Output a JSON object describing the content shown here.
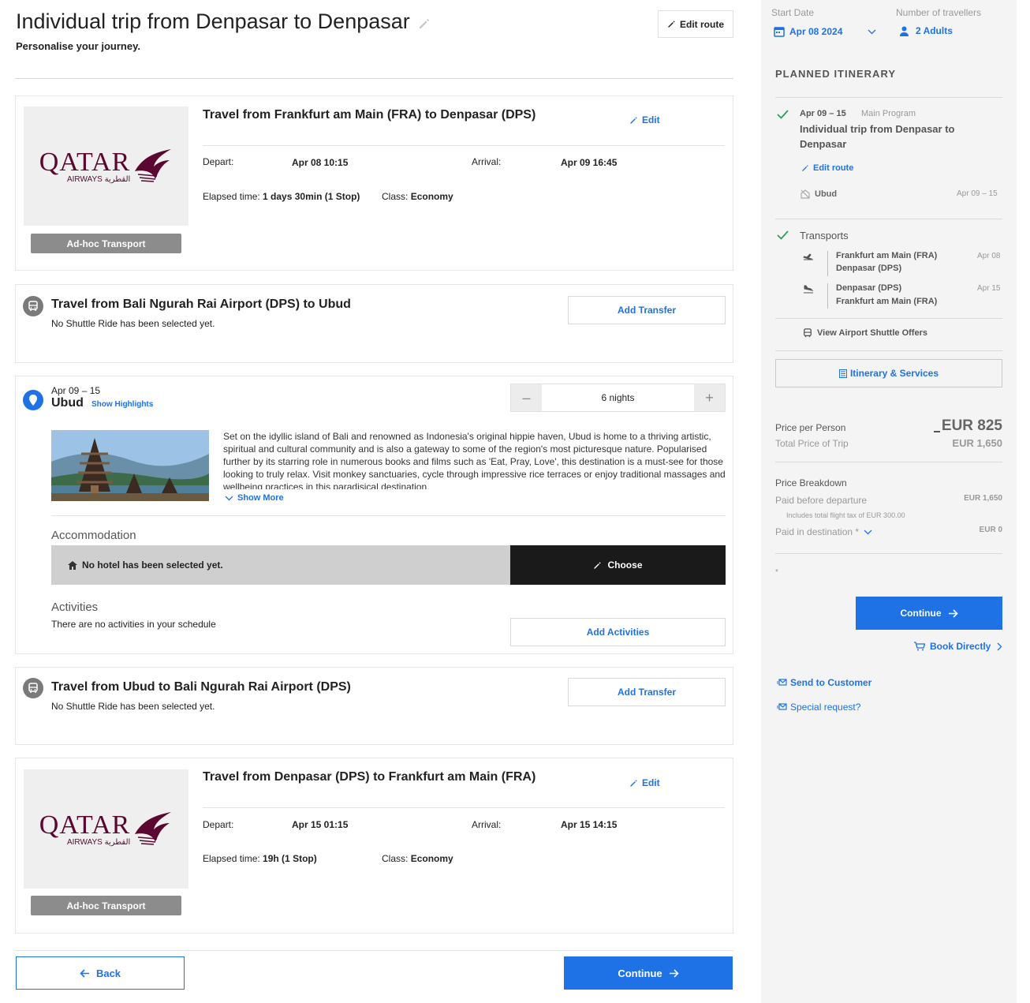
{
  "header": {
    "title": "Individual trip from Denpasar to Denpasar",
    "subtitle": "Personalise your journey.",
    "edit_route": "Edit route"
  },
  "flight_out": {
    "title": "Travel from Frankfurt am Main (FRA) to Denpasar (DPS)",
    "edit": "Edit",
    "depart_label": "Depart:",
    "depart": "Apr 08 10:15",
    "arrival_label": "Arrival:",
    "arrival": "Apr 09 16:45",
    "elapsed_label": "Elapsed time:",
    "elapsed": "1 days 30min (1 Stop)",
    "class_label": "Class:",
    "class": "Economy",
    "logo_text": "QATAR",
    "logo_sub": "AIRWAYS القطرية",
    "badge": "Ad-hoc Transport"
  },
  "transfer_in": {
    "title": "Travel from Bali Ngurah Rai Airport (DPS) to Ubud",
    "status": "No Shuttle Ride has been selected yet.",
    "button": "Add Transfer"
  },
  "destination": {
    "dates": "Apr 09 – 15",
    "name": "Ubud",
    "highlights": "Show Highlights",
    "nights": "6 nights",
    "description": "Set on the idyllic island of Bali and renowned as Indonesia's original hippie haven, Ubud is home to a thriving artistic, spiritual and cultural community and is also a gateway to some of the region's most picturesque nature. Popularised further by its starring role in numerous books and films such as 'Eat, Pray, Love', this destination is a must-see for those looking to truly relax. Visit monkey sanctuaries, cycle through impressive rice terraces or enjoy traditional massages and wellbeing practices in this paradisical destination.",
    "show_more": "Show More",
    "accommodation_label": "Accommodation",
    "no_hotel": "No hotel has been selected yet.",
    "choose": "Choose",
    "activities_label": "Activities",
    "no_activities": "There are no activities in your schedule",
    "add_activities": "Add Activities"
  },
  "transfer_out": {
    "title": "Travel from Ubud to Bali Ngurah Rai Airport (DPS)",
    "status": "No Shuttle Ride has been selected yet.",
    "button": "Add Transfer"
  },
  "flight_back": {
    "title": "Travel from Denpasar (DPS) to Frankfurt am Main (FRA)",
    "edit": "Edit",
    "depart_label": "Depart:",
    "depart": "Apr 15 01:15",
    "arrival_label": "Arrival:",
    "arrival": "Apr 15 14:15",
    "elapsed_label": "Elapsed time:",
    "elapsed": "19h (1 Stop)",
    "class_label": "Class:",
    "class": "Economy",
    "logo_text": "QATAR",
    "logo_sub": "AIRWAYS القطرية",
    "badge": "Ad-hoc Transport"
  },
  "footer": {
    "back": "Back",
    "continue": "Continue"
  },
  "sidebar": {
    "start_date_label": "Start Date",
    "start_date": "Apr 08 2024",
    "travellers_label": "Number of travellers",
    "travellers": "2 Adults",
    "itinerary_heading": "PLANNED ITINERARY",
    "program_dates": "Apr 09 – 15",
    "program_type": "Main Program",
    "program_title": "Individual trip from Denpasar to Denpasar",
    "edit_route": "Edit route",
    "stop_name": "Ubud",
    "stop_dates": "Apr 09 – 15",
    "transports_label": "Transports",
    "transports": [
      {
        "from": "Frankfurt am Main (FRA)",
        "to": "Denpasar (DPS)",
        "date": "Apr 08"
      },
      {
        "from": "Denpasar (DPS)",
        "to": "Frankfurt am Main (FRA)",
        "date": "Apr 15"
      }
    ],
    "shuttle_offers": "View Airport Shuttle Offers",
    "itinerary_services": "Itinerary & Services",
    "price_per_person_label": "Price per Person",
    "price_per_person": "EUR 825",
    "total_label": "Total Price of Trip",
    "total": "EUR 1,650",
    "breakdown_label": "Price Breakdown",
    "paid_before_label": "Paid before departure",
    "paid_before": "EUR 1,650",
    "tax_note": "Includes total flight tax of EUR 300.00",
    "paid_dest_label": "Paid in destination *",
    "paid_dest": "EUR 0",
    "asterisk": "*",
    "continue": "Continue",
    "book_directly": "Book Directly",
    "send_customer": "Send to Customer",
    "special_request": "Special request?"
  },
  "colors": {
    "accent": "#1f72e6",
    "qatar": "#5c0632",
    "check": "#2e9e5a"
  }
}
